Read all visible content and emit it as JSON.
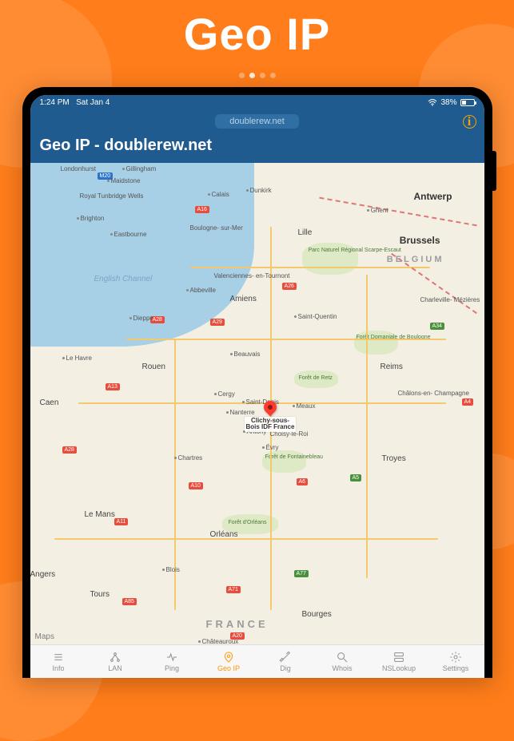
{
  "marketing": {
    "title": "Geo IP"
  },
  "status": {
    "time": "1:24 PM",
    "date": "Sat Jan 4",
    "battery_pct": "38%"
  },
  "nav": {
    "url_display": "doublerew.net"
  },
  "header": {
    "title": "Geo IP - doublerew.net"
  },
  "map": {
    "attribution_prefix": "",
    "attribution_brand": "Maps",
    "channel_label": "English\nChannel",
    "countries": {
      "france": "FRANCE",
      "belgium": "BELGIUM"
    },
    "pin_label": "Clichy-sous-\nBois IDF France",
    "parks": {
      "scarpe": "Parc Naturel\nRégional\nScarpe-Escaut",
      "retz": "Forêt de Retz",
      "fontainebleau": "Forêt de\nFontainebleau",
      "orleans": "Forêt d'Orléans",
      "boulogne": "Forêt Domaniale\nde Boulogne"
    },
    "cities": {
      "antwerp": "Antwerp",
      "brussels": "Brussels",
      "ghent": "Ghent",
      "lille": "Lille",
      "londonish": "Londonhurst",
      "gillingham": "Gillingham",
      "maidstone": "Maidstone",
      "royaltw": "Royal Tunbridge\nWells",
      "brighton": "Brighton",
      "eastbourne": "Eastbourne",
      "calais": "Calais",
      "dunkirk": "Dunkirk",
      "boulogne": "Boulogne-\nsur-Mer",
      "stquentin": "Saint-Quentin",
      "amiens": "Amiens",
      "abbeville": "Abbeville",
      "dieppe": "Dieppe",
      "lehavre": "Le Havre",
      "rouen": "Rouen",
      "caen": "Caen",
      "beauvais": "Beauvais",
      "cergy": "Cergy",
      "stdenis": "Saint-Denis",
      "nanterre": "Nanterre",
      "meaux": "Meaux",
      "antony": "Antony",
      "choisy": "Choisy-le-Roi",
      "evry": "Évry",
      "chartres": "Chartres",
      "orleans": "Orléans",
      "lemans": "Le Mans",
      "tours": "Tours",
      "angers": "Angers",
      "blois": "Blois",
      "chateauroux": "Châteauroux",
      "bourges": "Bourges",
      "reims": "Reims",
      "troyes": "Troyes",
      "chalons": "Châlons-en-\nChampagne",
      "charleville": "Charleville-\nMézières",
      "valenciennes": "Valenciennes-\nen-Tournont"
    },
    "badges": {
      "m20": "M20",
      "a16": "A16",
      "a26": "A26",
      "a28l": "A28",
      "a28r": "A28",
      "a29": "A29",
      "a4": "A4",
      "a13": "A13",
      "a10": "A10",
      "a11": "A11",
      "a6": "A6",
      "a5": "A5",
      "a71": "A71",
      "a77": "A77",
      "a85": "A85",
      "a20": "A20",
      "a34": "A34"
    }
  },
  "tabs": [
    {
      "id": "info",
      "label": "Info"
    },
    {
      "id": "lan",
      "label": "LAN"
    },
    {
      "id": "ping",
      "label": "Ping"
    },
    {
      "id": "geoip",
      "label": "Geo IP"
    },
    {
      "id": "dig",
      "label": "Dig"
    },
    {
      "id": "whois",
      "label": "Whois"
    },
    {
      "id": "nslookup",
      "label": "NSLookup"
    },
    {
      "id": "settings",
      "label": "Settings"
    }
  ],
  "active_tab": "geoip"
}
